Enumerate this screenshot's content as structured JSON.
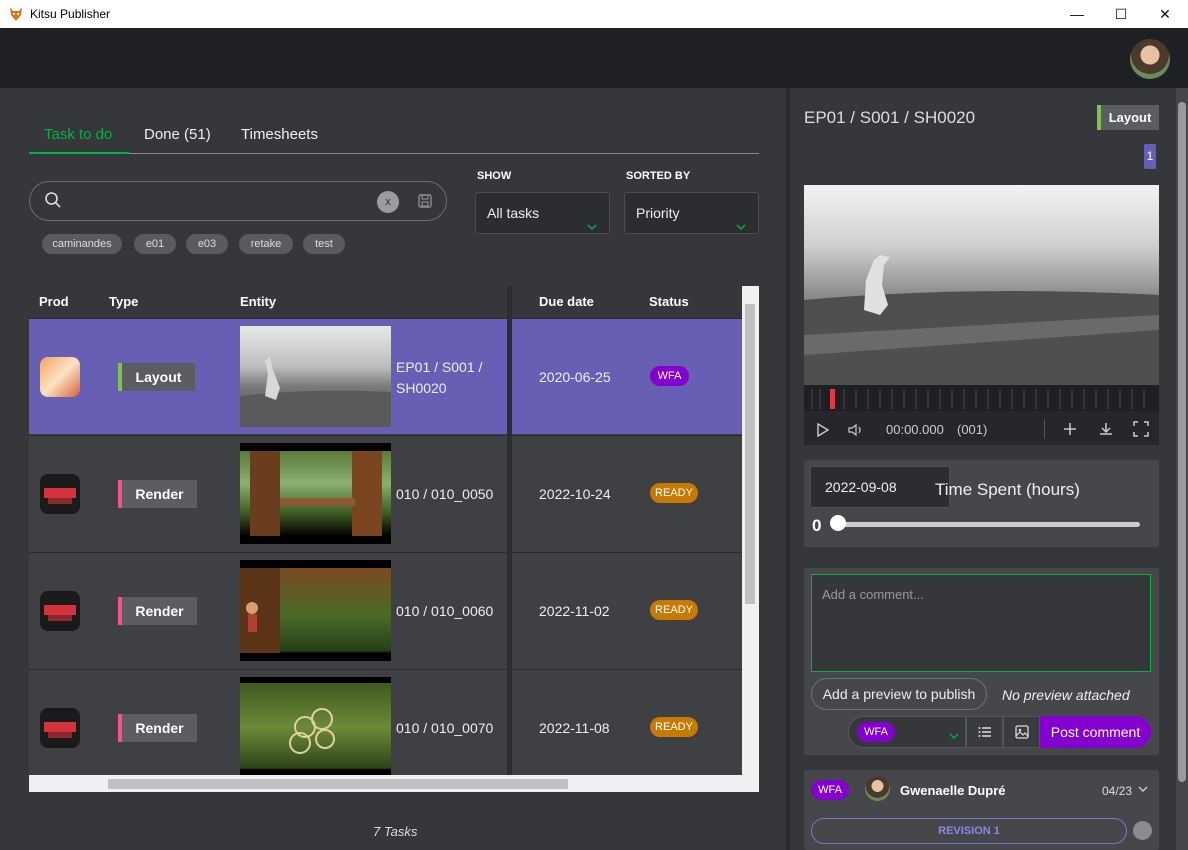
{
  "window": {
    "title": "Kitsu Publisher",
    "minimize": "—",
    "maximize": "☐",
    "close": "✕"
  },
  "tabs": [
    {
      "label": "Task to do"
    },
    {
      "label": "Done (51)"
    },
    {
      "label": "Timesheets"
    }
  ],
  "search": {
    "value": "",
    "clear_label": "x"
  },
  "tags": [
    "caminandes",
    "e01",
    "e03",
    "retake",
    "test"
  ],
  "filters": {
    "show_label": "SHOW",
    "show_value": "All tasks",
    "sort_label": "SORTED BY",
    "sort_value": "Priority"
  },
  "table": {
    "columns": [
      "Prod",
      "Type",
      "Entity",
      "Due date",
      "Status"
    ],
    "rows": [
      {
        "type": "Layout",
        "type_color": "#7ec44c",
        "entity": "EP01 / S001 / SH0020",
        "due": "2020-06-25",
        "status": "WFA",
        "status_color": "#8300ce",
        "selected": true
      },
      {
        "type": "Render",
        "type_color": "#ff4f8b",
        "entity": "010 / 010_0050",
        "due": "2022-10-24",
        "status": "READY",
        "status_color": "#c77a00",
        "selected": false
      },
      {
        "type": "Render",
        "type_color": "#ff4f8b",
        "entity": "010 / 010_0060",
        "due": "2022-11-02",
        "status": "READY",
        "status_color": "#c77a00",
        "selected": false
      },
      {
        "type": "Render",
        "type_color": "#ff4f8b",
        "entity": "010 / 010_0070",
        "due": "2022-11-08",
        "status": "READY",
        "status_color": "#c77a00",
        "selected": false
      }
    ],
    "count_label": "7 Tasks"
  },
  "detail": {
    "title": "EP01 / S001 / SH0020",
    "task_type": "Layout",
    "preview_count": "1",
    "timecode": "00:00.000",
    "frame": "(001)",
    "date": "2022-09-08",
    "time_label": "Time Spent (hours)",
    "time_value": "0",
    "comment_placeholder": "Add a comment...",
    "add_preview_label": "Add a preview to publish",
    "no_preview_label": "No preview attached",
    "status_value": "WFA",
    "post_label": "Post comment",
    "comment": {
      "status": "WFA",
      "author": "Gwenaelle Dupré",
      "date": "04/23",
      "revision": "REVISION 1"
    }
  },
  "colors": {
    "accent": "#00b242",
    "selected_row": "#675fb4",
    "wfa": "#8300ce",
    "ready": "#c77a00"
  }
}
